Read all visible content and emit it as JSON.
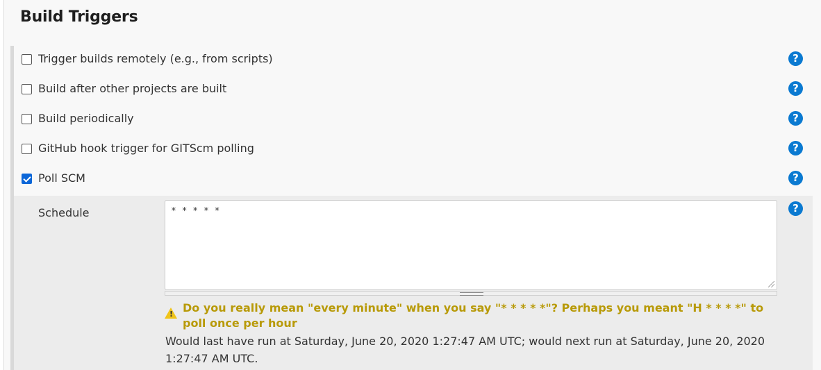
{
  "section": {
    "title": "Build Triggers"
  },
  "options": [
    {
      "label": "Trigger builds remotely (e.g., from scripts)",
      "checked": false
    },
    {
      "label": "Build after other projects are built",
      "checked": false
    },
    {
      "label": "Build periodically",
      "checked": false
    },
    {
      "label": "GitHub hook trigger for GITScm polling",
      "checked": false
    },
    {
      "label": "Poll SCM",
      "checked": true
    }
  ],
  "help": {
    "glyph": "?"
  },
  "schedule": {
    "label": "Schedule",
    "value": "* * * * *",
    "warning": "Do you really mean \"every minute\" when you say \"* * * * *\"? Perhaps you meant \"H * * * *\" to poll once per hour",
    "info": "Would last have run at Saturday, June 20, 2020 1:27:47 AM UTC; would next run at Saturday, June 20, 2020 1:27:47 AM UTC."
  },
  "colors": {
    "accent": "#0b7ad1",
    "checkbox": "#0b66d8",
    "warning": "#b89a08",
    "warning_icon": "#f0c419"
  }
}
